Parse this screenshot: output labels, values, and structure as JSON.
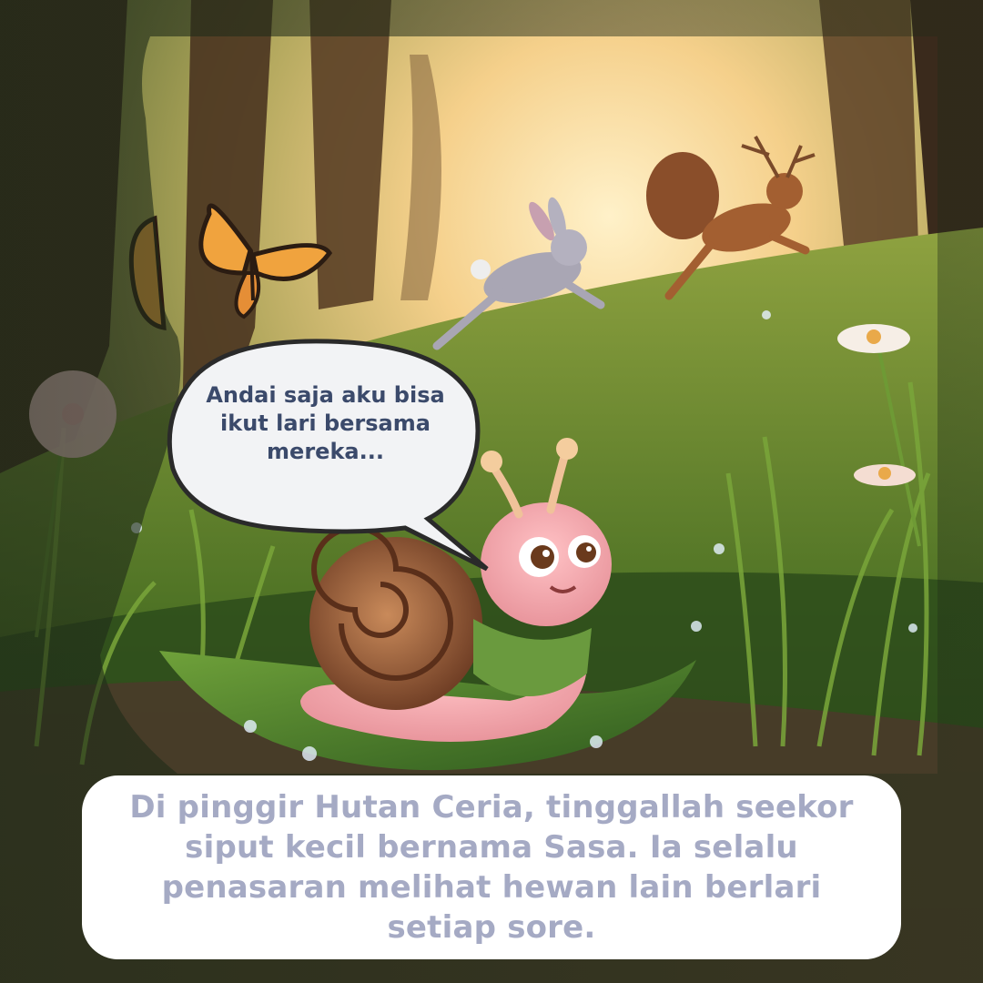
{
  "story_page": {
    "speech_bubble_text": "Andai saja aku bisa ikut lari bersama mereka...",
    "caption_text": "Di pinggir Hutan Ceria, tinggallah seekor siput kecil bernama Sasa. Ia selalu penasaran melihat hewan lain berlari setiap sore."
  },
  "colors": {
    "caption_text": "#a5aac4",
    "speech_text": "#3b4a6b",
    "caption_background": "#ffffff",
    "sunlight": "#f8d79a",
    "forest_green": "#4f6b2a"
  }
}
